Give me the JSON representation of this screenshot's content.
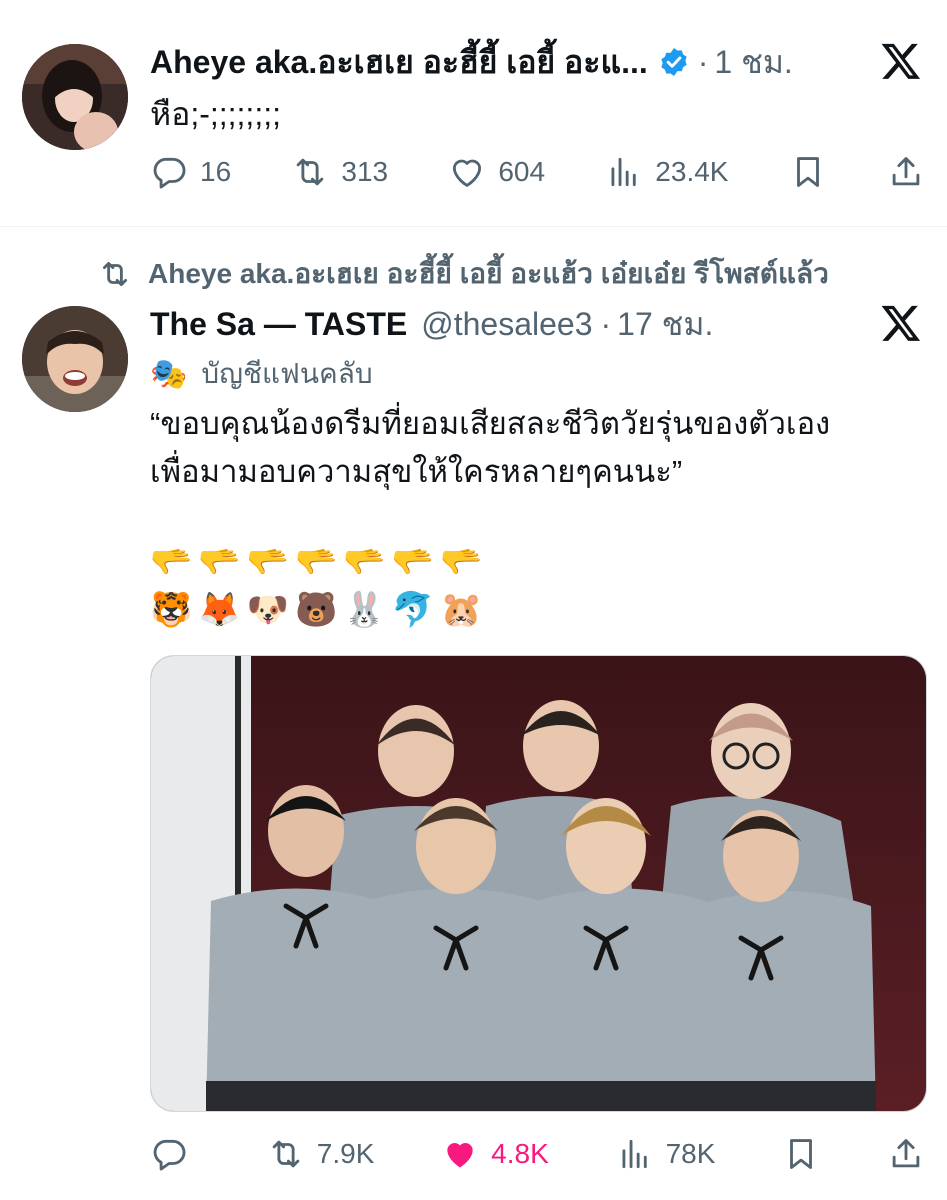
{
  "tweet1": {
    "display_name": "Aheye aka.อะเฮเย อะฮี้ยี้ เอยี้ อะแ...",
    "time": "1 ชม.",
    "text": "หือ;-;;;;;;;;",
    "actions": {
      "replies": "16",
      "reposts": "313",
      "likes": "604",
      "views": "23.4K"
    }
  },
  "repost_context": {
    "text": "Aheye aka.อะเฮเย อะฮี้ยี้ เอยี้ อะแฮ้ว เอ๋ยเอ๋ย รีโพสต์แล้ว"
  },
  "tweet2": {
    "display_name": "The Sa — TASTE",
    "handle": "@thesalee3",
    "time": "17 ชม.",
    "fan_account_label": "บัญชีแฟนคลับ",
    "text_line1": "“ขอบคุณน้องดรีมที่ยอมเสียสละชีวิตวัยรุ่นของตัวเอง",
    "text_line2": "เพื่อมามอบความสุขให้ใครหลายๆคนนะ”",
    "emoji_line1": "🫳🫳🫳🫳🫳🫳🫳",
    "emoji_line2": "🐯🦊🐶🐻🐰🐬🐹",
    "actions": {
      "replies": "",
      "reposts": "7.9K",
      "likes": "4.8K",
      "views": "78K"
    }
  },
  "colors": {
    "text": "#0f1419",
    "muted": "#536471",
    "verified": "#1d9bf0",
    "like_active": "#f91880",
    "divider": "#eff3f4"
  },
  "icons": [
    "verified-badge-icon",
    "x-logo-icon",
    "reply-icon",
    "repost-icon",
    "like-icon",
    "views-icon",
    "bookmark-icon",
    "share-icon",
    "theater-mask-icon"
  ]
}
